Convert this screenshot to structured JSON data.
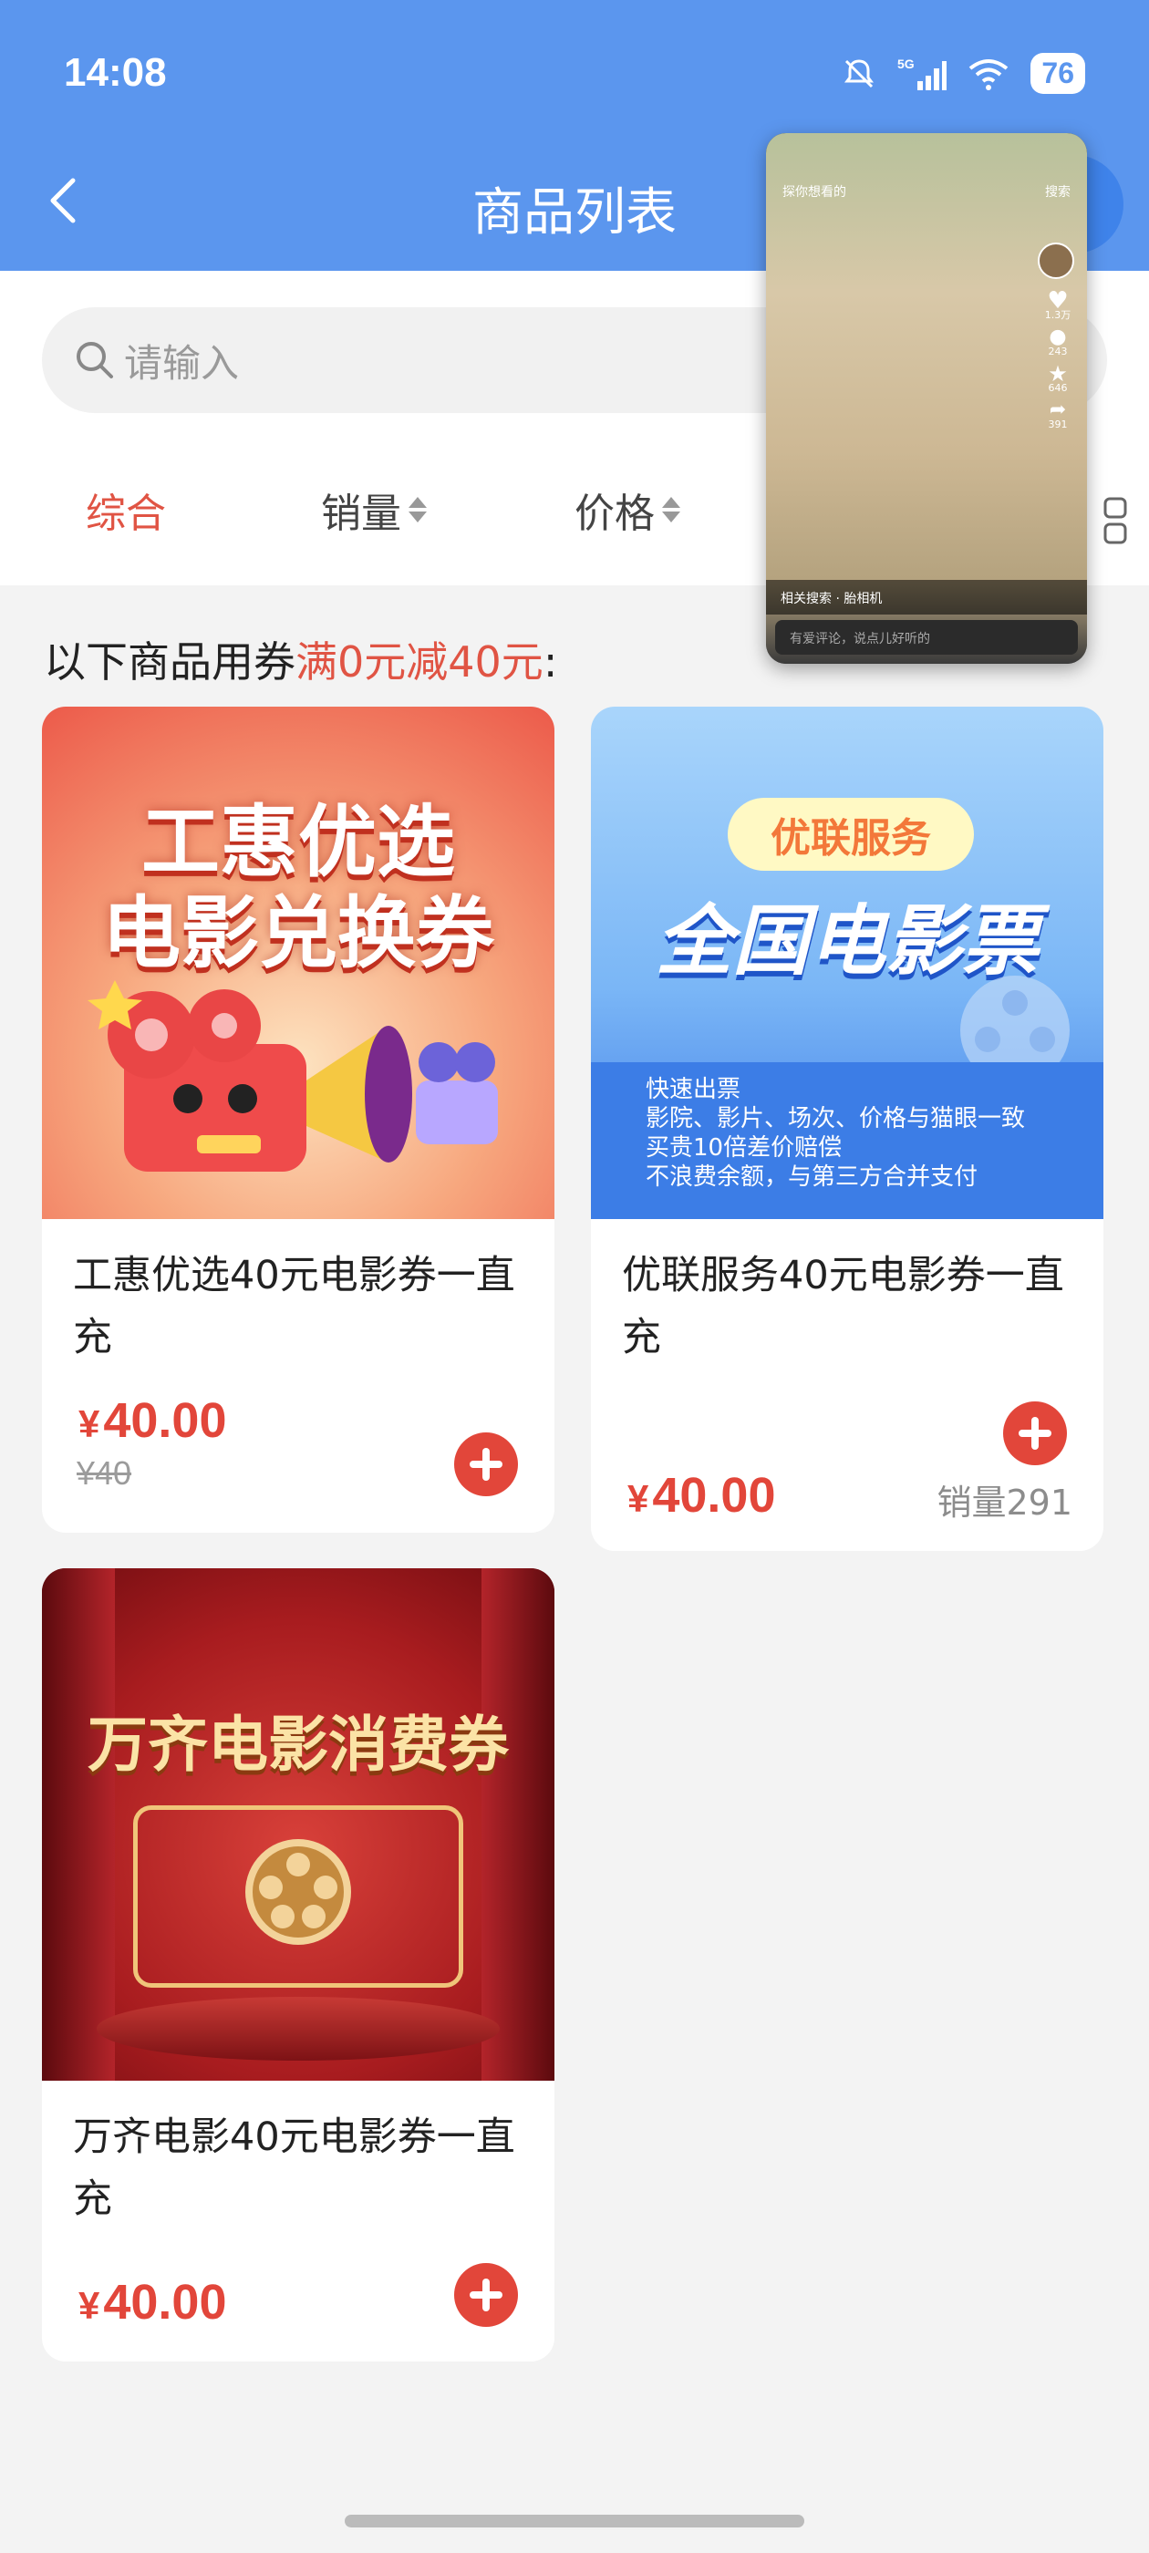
{
  "status_bar": {
    "time": "14:08",
    "network": "5G",
    "battery": "76"
  },
  "header": {
    "title": "商品列表"
  },
  "search": {
    "placeholder": "请输入"
  },
  "sort_bar": {
    "items": [
      "综合",
      "销量",
      "价格"
    ]
  },
  "coupon_tip": {
    "prefix": "以下商品用券",
    "highlight": "满0元减40元",
    "suffix": ":"
  },
  "products": [
    {
      "thumb_line1": "工惠优选",
      "thumb_line2": "电影兑换券",
      "name": "工惠优选40元电影券一直充",
      "price": "40.00",
      "currency": "¥",
      "original_price": "¥40"
    },
    {
      "thumb_badge": "优联服务",
      "thumb_title": "全国电影票",
      "thumb_bullets": [
        "快速出票",
        "影院、影片、场次、价格与猫眼一致",
        "买贵10倍差价赔偿",
        "不浪费余额，与第三方合并支付"
      ],
      "name": "优联服务40元电影券一直充",
      "price": "40.00",
      "currency": "¥",
      "sales": "销量291"
    },
    {
      "thumb_title": "万齐电影消费券",
      "name": "万齐电影40元电影券一直充",
      "price": "40.00",
      "currency": "¥"
    }
  ],
  "floating_video": {
    "search_hint": "探你想看的",
    "search_button": "搜索",
    "likes": "1.3万",
    "comments": "243",
    "favorites": "646",
    "shares": "391",
    "related": "相关搜索 · 胎相机",
    "comment_placeholder": "有爱评论，说点儿好听的"
  },
  "colors": {
    "header_blue": "#5b96ee",
    "accent_red": "#e2463a",
    "background": "#f3f3f3"
  }
}
